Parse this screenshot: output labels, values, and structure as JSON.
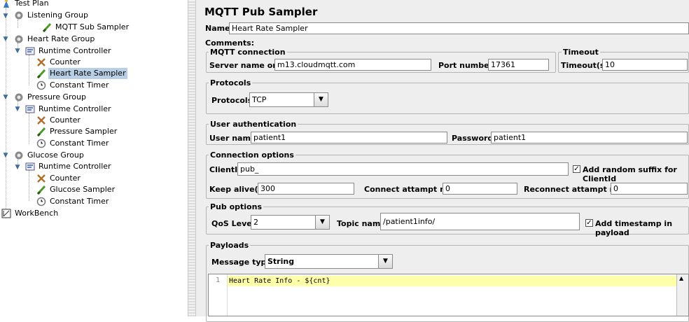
{
  "tree": {
    "items": [
      {
        "label": "Test Plan",
        "icon": "test-plan-icon"
      },
      {
        "label": "Listening Group",
        "icon": "thread-group-icon"
      },
      {
        "label": "MQTT Sub Sampler",
        "icon": "sampler-icon"
      },
      {
        "label": "Heart Rate Group",
        "icon": "thread-group-icon"
      },
      {
        "label": "Runtime Controller",
        "icon": "controller-icon"
      },
      {
        "label": "Counter",
        "icon": "counter-icon"
      },
      {
        "label": "Heart Rate Sampler",
        "icon": "sampler-icon"
      },
      {
        "label": "Constant Timer",
        "icon": "timer-icon"
      },
      {
        "label": "Pressure Group",
        "icon": "thread-group-icon"
      },
      {
        "label": "Runtime Controller",
        "icon": "controller-icon"
      },
      {
        "label": "Counter",
        "icon": "counter-icon"
      },
      {
        "label": "Pressure Sampler",
        "icon": "sampler-icon"
      },
      {
        "label": "Constant Timer",
        "icon": "timer-icon"
      },
      {
        "label": "Glucose Group",
        "icon": "thread-group-icon"
      },
      {
        "label": "Runtime Controller",
        "icon": "controller-icon"
      },
      {
        "label": "Counter",
        "icon": "counter-icon"
      },
      {
        "label": "Glucose Sampler",
        "icon": "sampler-icon"
      },
      {
        "label": "Constant Timer",
        "icon": "timer-icon"
      },
      {
        "label": "WorkBench",
        "icon": "workbench-icon"
      }
    ],
    "selected_label": "Heart Rate Sampler"
  },
  "panel": {
    "title": "MQTT Pub Sampler",
    "name_label": "Name:",
    "name_value": "Heart Rate Sampler",
    "comments_label": "Comments:",
    "mqtt_connection": {
      "legend": "MQTT connection",
      "server_label": "Server name or IP:",
      "server_value": "m13.cloudmqtt.com",
      "port_label": "Port number:",
      "port_value": "17361"
    },
    "timeout": {
      "legend": "Timeout",
      "label": "Timeout(s):",
      "value": "10"
    },
    "protocols": {
      "legend": "Protocols",
      "label": "Protocols:",
      "value": "TCP"
    },
    "auth": {
      "legend": "User authentication",
      "user_label": "User name:",
      "user_value": "patient1",
      "password_label": "Password:",
      "password_value": "patient1"
    },
    "connection": {
      "legend": "Connection options",
      "clientid_label": "ClientId:",
      "clientid_value": "pub_",
      "random_suffix_label": "Add random suffix for ClientId",
      "random_suffix_checked": true,
      "keepalive_label": "Keep alive(s):",
      "keepalive_value": "300",
      "connect_max_label": "Connect attampt max:",
      "connect_max_value": "0",
      "reconnect_max_label": "Reconnect attampt max:",
      "reconnect_max_value": "0"
    },
    "pub": {
      "legend": "Pub options",
      "qos_label": "QoS Level:",
      "qos_value": "2",
      "topic_label": "Topic name:",
      "topic_value": "/patient1info/",
      "timestamp_label": "Add timestamp in payload",
      "timestamp_checked": true
    },
    "payloads": {
      "legend": "Payloads",
      "type_label": "Message type:",
      "type_value": "String",
      "line_number": "1",
      "code": "Heart Rate Info - ${cnt}"
    }
  }
}
